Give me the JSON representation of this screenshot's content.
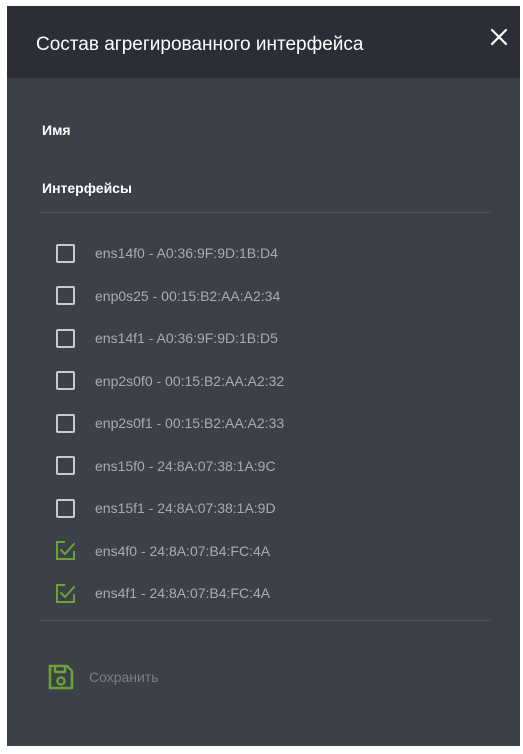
{
  "dialog": {
    "title": "Состав агрегированного интерфейса",
    "close_icon": "close-icon"
  },
  "form": {
    "name_label": "Имя",
    "interfaces_label": "Интерфейсы"
  },
  "interfaces": [
    {
      "label": "ens14f0 - A0:36:9F:9D:1B:D4",
      "checked": false
    },
    {
      "label": "enp0s25 - 00:15:B2:AA:A2:34",
      "checked": false
    },
    {
      "label": "ens14f1 - A0:36:9F:9D:1B:D5",
      "checked": false
    },
    {
      "label": "enp2s0f0 - 00:15:B2:AA:A2:32",
      "checked": false
    },
    {
      "label": "enp2s0f1 - 00:15:B2:AA:A2:33",
      "checked": false
    },
    {
      "label": "ens15f0 - 24:8A:07:38:1A:9C",
      "checked": false
    },
    {
      "label": "ens15f1 - 24:8A:07:38:1A:9D",
      "checked": false
    },
    {
      "label": "ens4f0 - 24:8A:07:B4:FC:4A",
      "checked": true
    },
    {
      "label": "ens4f1 - 24:8A:07:B4:FC:4A",
      "checked": true
    }
  ],
  "actions": {
    "save_label": "Сохранить",
    "save_icon": "floppy-disk-icon",
    "save_disabled": true
  },
  "colors": {
    "panel_bg": "#3c4048",
    "header_bg": "#2b2e35",
    "accent_green": "#6aa233",
    "text_muted": "#a9acb2"
  }
}
